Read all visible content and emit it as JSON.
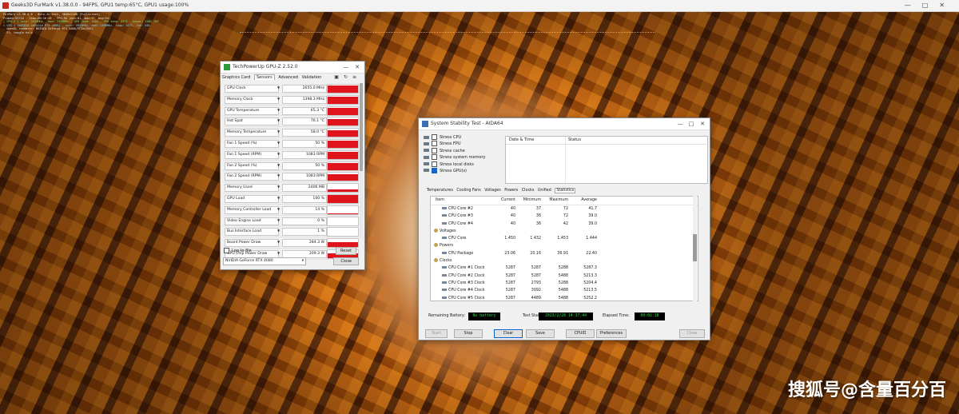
{
  "furmark": {
    "title": "Geeks3D FurMark v1.38.0.0 - 94FPS, GPU1 temp:65°C, GPU1 usage:100%",
    "overlay_lines": [
      "FurMark v1.38.0.0 - Burn-in test, 3840x2160 (Fullscreen)",
      "Frames:92744 - time:00:16:26 - FPS:94 (min:81, max:97, avg:94)",
      "[ GPU-Z ] core: 2655MHz - mem: 1398MHz - GPU load: 100% - GPU temp: 65°C - power: 100% TDP",
      "> GPU 1 (NVIDIA GeForce RTX 4080) - core: 2655MHz, mem: 1398MHz, temp: 65°C, fan: 50%",
      "- OpenGL renderer: NVIDIA GeForce RTX 4080/PCIe/SSE2",
      "- F1: toggle help"
    ]
  },
  "gpuz": {
    "title": "TechPowerUp GPU-Z 2.52.0",
    "tabs": [
      "Graphics Card",
      "Sensors",
      "Advanced",
      "Validation"
    ],
    "active_tab": "Sensors",
    "sensors": [
      {
        "name": "GPU Clock",
        "value": "2655.0 MHz",
        "level": 0.9
      },
      {
        "name": "Memory Clock",
        "value": "1398.3 MHz",
        "level": 0.9
      },
      {
        "name": "GPU Temperature",
        "value": "65.3 °C",
        "level": 0.85
      },
      {
        "name": "Hot Spot",
        "value": "76.1 °C",
        "level": 0.85
      },
      {
        "name": "Memory Temperature",
        "value": "58.0 °C",
        "level": 0.85
      },
      {
        "name": "Fan 1 Speed (%)",
        "value": "50 %",
        "level": 0.85
      },
      {
        "name": "Fan 1 Speed (RPM)",
        "value": "1083 RPM",
        "level": 0.85
      },
      {
        "name": "Fan 2 Speed (%)",
        "value": "50 %",
        "level": 0.85
      },
      {
        "name": "Fan 2 Speed (RPM)",
        "value": "1083 RPM",
        "level": 0.85
      },
      {
        "name": "Memory Used",
        "value": "2406 MB",
        "level": 0.35
      },
      {
        "name": "GPU Load",
        "value": "100 %",
        "level": 0.95
      },
      {
        "name": "Memory Controller Load",
        "value": "14 %",
        "level": 0.12
      },
      {
        "name": "Video Engine Load",
        "value": "0 %",
        "level": 0
      },
      {
        "name": "Bus Interface Load",
        "value": "1 %",
        "level": 0.03
      },
      {
        "name": "Board Power Draw",
        "value": "284.3 W",
        "level": 0.65
      },
      {
        "name": "GPU Chip Power Draw",
        "value": "209.3 W",
        "level": 0.6
      }
    ],
    "log_label": "Log to file",
    "reset_label": "Reset",
    "gpu_select": "NVIDIA GeForce RTX 4080",
    "close_label": "Close"
  },
  "aida": {
    "title": "System Stability Test - AIDA64",
    "stress_items": [
      {
        "label": "Stress CPU",
        "checked": false
      },
      {
        "label": "Stress FPU",
        "checked": false
      },
      {
        "label": "Stress cache",
        "checked": false
      },
      {
        "label": "Stress system memory",
        "checked": false
      },
      {
        "label": "Stress local disks",
        "checked": false
      },
      {
        "label": "Stress GPU(s)",
        "checked": true
      }
    ],
    "log_headers": [
      "Date & Time",
      "Status"
    ],
    "tabs": [
      "Temperatures",
      "Cooling Fans",
      "Voltages",
      "Powers",
      "Clocks",
      "Unified",
      "Statistics"
    ],
    "active_tab": "Statistics",
    "stats_headers": [
      "Item",
      "Current",
      "Minimum",
      "Maximum",
      "Average"
    ],
    "stats_rows": [
      {
        "item": "CPU Core #2",
        "cur": "40",
        "min": "37",
        "max": "72",
        "avg": "41.7",
        "group": false
      },
      {
        "item": "CPU Core #3",
        "cur": "40",
        "min": "36",
        "max": "72",
        "avg": "39.0",
        "group": false
      },
      {
        "item": "CPU Core #4",
        "cur": "40",
        "min": "36",
        "max": "42",
        "avg": "39.0",
        "group": false
      },
      {
        "item": "Voltages",
        "cur": "",
        "min": "",
        "max": "",
        "avg": "",
        "group": true
      },
      {
        "item": "CPU Core",
        "cur": "1.450",
        "min": "1.432",
        "max": "1.453",
        "avg": "1.444",
        "group": false
      },
      {
        "item": "Powers",
        "cur": "",
        "min": "",
        "max": "",
        "avg": "",
        "group": true
      },
      {
        "item": "CPU Package",
        "cur": "23.06",
        "min": "20.16",
        "max": "36.91",
        "avg": "22.40",
        "group": false
      },
      {
        "item": "Clocks",
        "cur": "",
        "min": "",
        "max": "",
        "avg": "",
        "group": true
      },
      {
        "item": "CPU Core #1 Clock",
        "cur": "5287",
        "min": "5287",
        "max": "5288",
        "avg": "5287.3",
        "group": false
      },
      {
        "item": "CPU Core #2 Clock",
        "cur": "5287",
        "min": "5287",
        "max": "5488",
        "avg": "5213.3",
        "group": false
      },
      {
        "item": "CPU Core #3 Clock",
        "cur": "5287",
        "min": "2793",
        "max": "5288",
        "avg": "5204.4",
        "group": false
      },
      {
        "item": "CPU Core #4 Clock",
        "cur": "5287",
        "min": "3092",
        "max": "5488",
        "avg": "5213.5",
        "group": false
      },
      {
        "item": "CPU Core #5 Clock",
        "cur": "5287",
        "min": "4489",
        "max": "5488",
        "avg": "5252.2",
        "group": false
      }
    ],
    "remaining_label": "Remaining Battery:",
    "remaining_value": "No battery",
    "test_started_label": "Test Started:",
    "test_started_value": "2023/2/28 14:37:44",
    "elapsed_label": "Elapsed Time:",
    "elapsed_value": "00:02:18",
    "buttons": {
      "start": "Start",
      "stop": "Stop",
      "clear": "Clear",
      "save": "Save",
      "cpuid": "CPUID",
      "preferences": "Preferences",
      "close": "Close"
    }
  },
  "watermark": "搜狐号@含量百分百"
}
